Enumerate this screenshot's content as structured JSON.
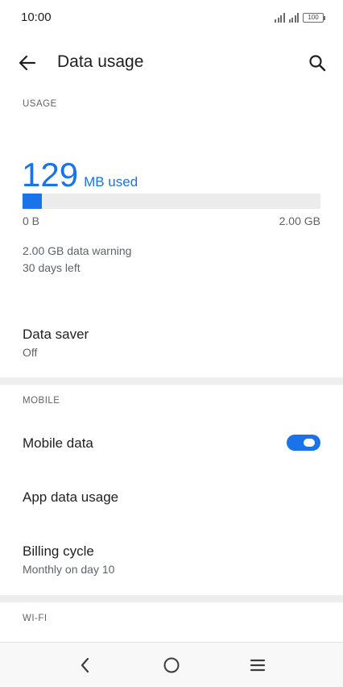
{
  "status_bar": {
    "time": "10:00",
    "battery": "100"
  },
  "app_bar": {
    "title": "Data usage"
  },
  "usage": {
    "section_label": "USAGE",
    "amount": "129",
    "unit": "MB used",
    "progress_fraction": 0.0645,
    "range_min": "0 B",
    "range_max": "2.00 GB",
    "warning": "2.00 GB data warning",
    "days_left": "30 days left"
  },
  "data_saver": {
    "title": "Data saver",
    "subtitle": "Off"
  },
  "mobile": {
    "section_label": "MOBILE",
    "mobile_data_label": "Mobile data",
    "mobile_data_enabled": true,
    "app_data_usage_label": "App data usage",
    "billing_cycle_label": "Billing cycle",
    "billing_cycle_value": "Monthly on day 10"
  },
  "wifi": {
    "section_label": "WI-FI"
  },
  "colors": {
    "accent": "#1a73e8",
    "divider": "#eeeeee"
  },
  "nav_bar": {
    "icons": [
      "back-icon",
      "home-icon",
      "menu-icon"
    ]
  }
}
